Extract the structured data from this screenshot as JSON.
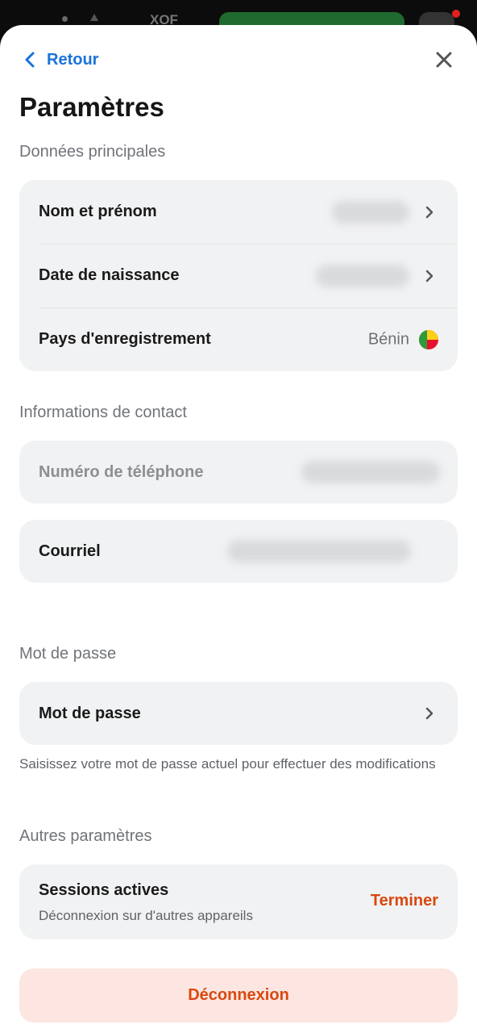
{
  "status_bar": {
    "currency": "XOF"
  },
  "nav": {
    "back_label": "Retour"
  },
  "page": {
    "title": "Paramètres"
  },
  "sections": {
    "main_data": {
      "label": "Données principales",
      "rows": [
        {
          "label": "Nom et prénom",
          "value_hidden": true
        },
        {
          "label": "Date de naissance",
          "value_hidden": true
        },
        {
          "label": "Pays d'enregistrement",
          "value": "Bénin",
          "icon": "benin-flag-icon"
        }
      ]
    },
    "contact": {
      "label": "Informations de contact",
      "phone": {
        "label": "Numéro de téléphone",
        "value_hidden": true
      },
      "email": {
        "label": "Courriel",
        "value_hidden": true
      }
    },
    "password": {
      "label": "Mot de passe",
      "row_label": "Mot de passe",
      "hint": "Saisissez votre mot de passe actuel pour effectuer des modifications"
    },
    "other": {
      "label": "Autres paramètres",
      "sessions_title": "Sessions actives",
      "sessions_subtitle": "Déconnexion sur d'autres appareils",
      "sessions_action": "Terminer"
    }
  },
  "logout_label": "Déconnexion",
  "colors": {
    "accent_blue": "#1a73d9",
    "danger_orange": "#d9480f",
    "danger_bg": "#fde6e1",
    "card_bg": "#f1f2f3"
  }
}
